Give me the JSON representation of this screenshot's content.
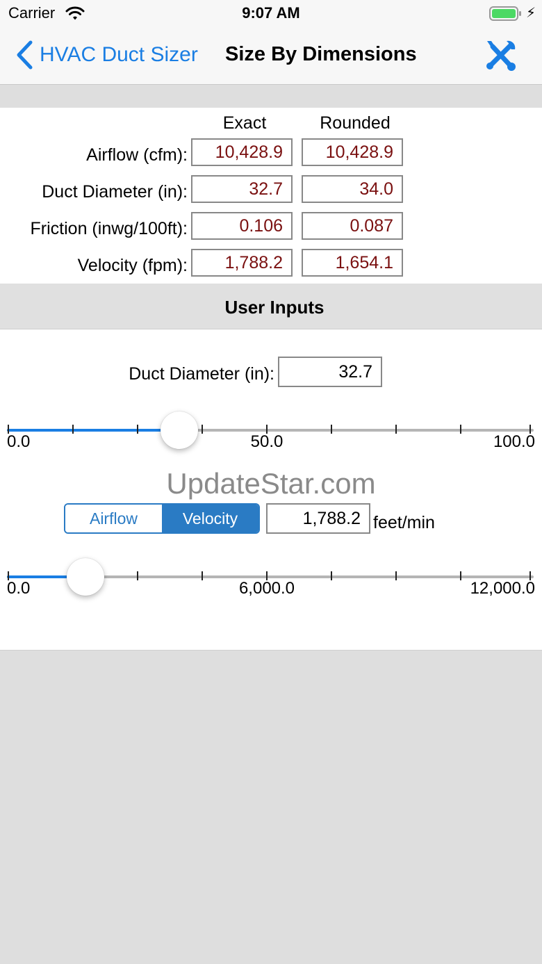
{
  "status_bar": {
    "carrier": "Carrier",
    "time": "9:07 AM"
  },
  "nav": {
    "back_label": "HVAC Duct Sizer",
    "title": "Size By Dimensions"
  },
  "results": {
    "headers": {
      "exact": "Exact",
      "rounded": "Rounded"
    },
    "rows": [
      {
        "label": "Airflow (cfm):",
        "exact": "10,428.9",
        "rounded": "10,428.9"
      },
      {
        "label": "Duct Diameter (in):",
        "exact": "32.7",
        "rounded": "34.0"
      },
      {
        "label": "Friction (inwg/100ft):",
        "exact": "0.106",
        "rounded": "0.087"
      },
      {
        "label": "Velocity (fpm):",
        "exact": "1,788.2",
        "rounded": "1,654.1"
      }
    ]
  },
  "user_inputs": {
    "title": "User Inputs",
    "diameter": {
      "label": "Duct Diameter (in):",
      "value": "32.7",
      "slider": {
        "min_label": "0.0",
        "mid_label": "50.0",
        "max_label": "100.0",
        "min": 0,
        "max": 100,
        "current": 32.7
      }
    },
    "mode": {
      "options": [
        "Airflow",
        "Velocity"
      ],
      "selected": "Velocity",
      "value": "1,788.2",
      "unit": "feet/min",
      "slider": {
        "min_label": "0.0",
        "mid_label": "6,000.0",
        "max_label": "12,000.0",
        "min": 0,
        "max": 12000,
        "current": 1788.2
      }
    }
  },
  "watermark": "UpdateStar.com",
  "colors": {
    "accent": "#1a7ee3",
    "segment": "#2a7bc4",
    "value_text": "#7a1010",
    "battery": "#4cd964"
  },
  "icons": [
    "wifi-icon",
    "battery-icon",
    "back-chevron-icon",
    "tools-icon"
  ]
}
